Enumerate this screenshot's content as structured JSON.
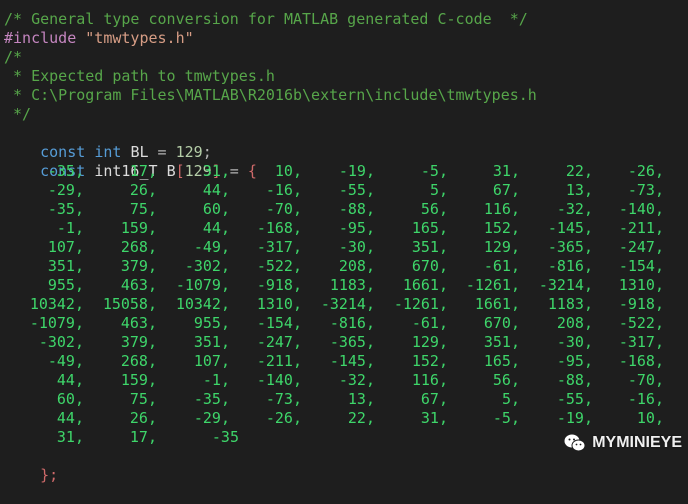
{
  "header_lines": [
    {
      "kind": "comment",
      "text": "/* General type conversion for MATLAB generated C-code  */"
    },
    {
      "kind": "include",
      "directive": "#include",
      "file": "\"tmwtypes.h\""
    },
    {
      "kind": "comment",
      "text": "/*"
    },
    {
      "kind": "comment",
      "text": " * Expected path to tmwtypes.h"
    },
    {
      "kind": "comment",
      "text": " * C:\\Program Files\\MATLAB\\R2016b\\extern\\include\\tmwtypes.h"
    },
    {
      "kind": "comment",
      "text": " */"
    }
  ],
  "bl_decl": {
    "keyword": "const",
    "type": "int",
    "name": "BL",
    "op": "=",
    "value": "129",
    "end": ";"
  },
  "b_decl": {
    "keyword": "const",
    "type": "int16_T",
    "name": "B",
    "open_bracket": "[",
    "size": "129",
    "close_bracket": "]",
    "op": "=",
    "open_brace": "{"
  },
  "coefficients": [
    [
      "-35,",
      "17,",
      "31,",
      "10,",
      "-19,",
      "-5,",
      "31,",
      "22,",
      "-26,"
    ],
    [
      "-29,",
      "26,",
      "44,",
      "-16,",
      "-55,",
      "5,",
      "67,",
      "13,",
      "-73,"
    ],
    [
      "-35,",
      "75,",
      "60,",
      "-70,",
      "-88,",
      "56,",
      "116,",
      "-32,",
      "-140,"
    ],
    [
      "-1,",
      "159,",
      "44,",
      "-168,",
      "-95,",
      "165,",
      "152,",
      "-145,",
      "-211,"
    ],
    [
      "107,",
      "268,",
      "-49,",
      "-317,",
      "-30,",
      "351,",
      "129,",
      "-365,",
      "-247,"
    ],
    [
      "351,",
      "379,",
      "-302,",
      "-522,",
      "208,",
      "670,",
      "-61,",
      "-816,",
      "-154,"
    ],
    [
      "955,",
      "463,",
      "-1079,",
      "-918,",
      "1183,",
      "1661,",
      "-1261,",
      "-3214,",
      "1310,"
    ],
    [
      "10342,",
      "15058,",
      "10342,",
      "1310,",
      "-3214,",
      "-1261,",
      "1661,",
      "1183,",
      "-918,"
    ],
    [
      "-1079,",
      "463,",
      "955,",
      "-154,",
      "-816,",
      "-61,",
      "670,",
      "208,",
      "-522,"
    ],
    [
      "-302,",
      "379,",
      "351,",
      "-247,",
      "-365,",
      "129,",
      "351,",
      "-30,",
      "-317,"
    ],
    [
      "-49,",
      "268,",
      "107,",
      "-211,",
      "-145,",
      "152,",
      "165,",
      "-95,",
      "-168,"
    ],
    [
      "44,",
      "159,",
      "-1,",
      "-140,",
      "-32,",
      "116,",
      "56,",
      "-88,",
      "-70,"
    ],
    [
      "60,",
      "75,",
      "-35,",
      "-73,",
      "13,",
      "67,",
      "5,",
      "-55,",
      "-16,"
    ],
    [
      "44,",
      "26,",
      "-29,",
      "-26,",
      "22,",
      "31,",
      "-5,",
      "-19,",
      "10,"
    ],
    [
      "31,",
      "17,",
      "-35"
    ]
  ],
  "closing": "};",
  "watermark": {
    "icon": "wechat-icon",
    "text": "MYMINIEYE"
  },
  "colors": {
    "background": "#1e1e1e",
    "comment": "#57a64a",
    "preprocessor": "#c586c0",
    "string": "#d69d85",
    "keyword": "#569cd6",
    "number": "#b5cea8",
    "array_value": "#3ed66a",
    "bracket": "#cf6a6a"
  }
}
